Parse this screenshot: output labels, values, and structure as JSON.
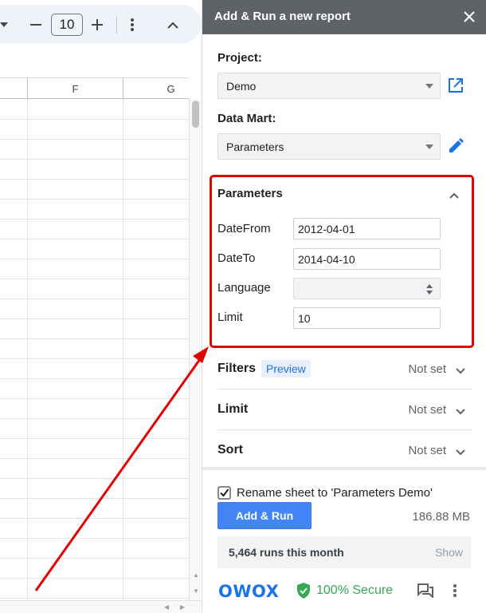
{
  "sheet": {
    "zoom_value": "10",
    "columns": [
      "F",
      "G"
    ]
  },
  "panel": {
    "title": "Add & Run a new report",
    "project_label": "Project:",
    "project_value": "Demo",
    "datamart_label": "Data Mart:",
    "datamart_value": "Parameters",
    "parameters_heading": "Parameters",
    "params": [
      {
        "label": "DateFrom",
        "value": "2012-04-01"
      },
      {
        "label": "DateTo",
        "value": "2014-04-10"
      },
      {
        "label": "Language",
        "value": ""
      },
      {
        "label": "Limit",
        "value": "10"
      }
    ],
    "sections": [
      {
        "label": "Filters",
        "badge": "Preview",
        "status": "Not set"
      },
      {
        "label": "Limit",
        "status": "Not set"
      },
      {
        "label": "Sort",
        "status": "Not set"
      }
    ],
    "rename_label": "Rename sheet to 'Parameters Demo'",
    "rename_checked": true,
    "run_button": "Add & Run",
    "size": "186.88 MB",
    "runs_text": "5,464 runs this month",
    "show_link": "Show",
    "logo": "OWOX",
    "secure_text": "100% Secure"
  },
  "colors": {
    "accent": "#1a73e8",
    "button": "#4285f4",
    "header": "#5f6368",
    "highlight": "#e00000",
    "secure": "#34a853"
  }
}
